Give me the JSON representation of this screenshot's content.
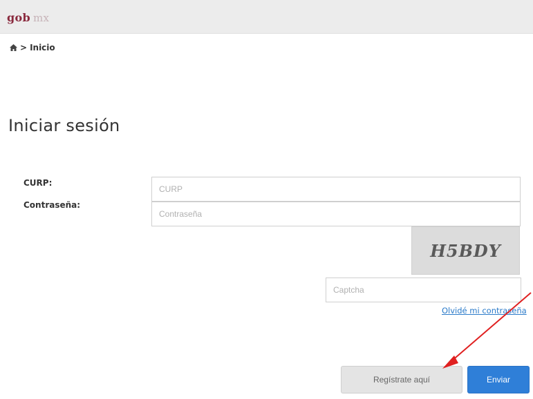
{
  "header": {
    "logo_main": "gob",
    "logo_suffix": "mx"
  },
  "breadcrumb": {
    "separator": ">",
    "current": "Inicio",
    "home_icon": "home-icon"
  },
  "page": {
    "title": "Iniciar sesión"
  },
  "form": {
    "curp_label": "CURP:",
    "curp_placeholder": "CURP",
    "curp_value": "",
    "password_label": "Contraseña:",
    "password_placeholder": "Contraseña",
    "password_value": "",
    "captcha_image_text": "H5BDY",
    "captcha_placeholder": "Captcha",
    "captcha_value": "",
    "forgot_password_link": "Olvidé mi contraseña"
  },
  "actions": {
    "register_label": "Regístrate aquí",
    "submit_label": "Enviar"
  },
  "colors": {
    "brand": "#8a2a3e",
    "link": "#2a7ac9",
    "primary_button": "#2f7fd8",
    "annotation_arrow": "#e02020"
  }
}
